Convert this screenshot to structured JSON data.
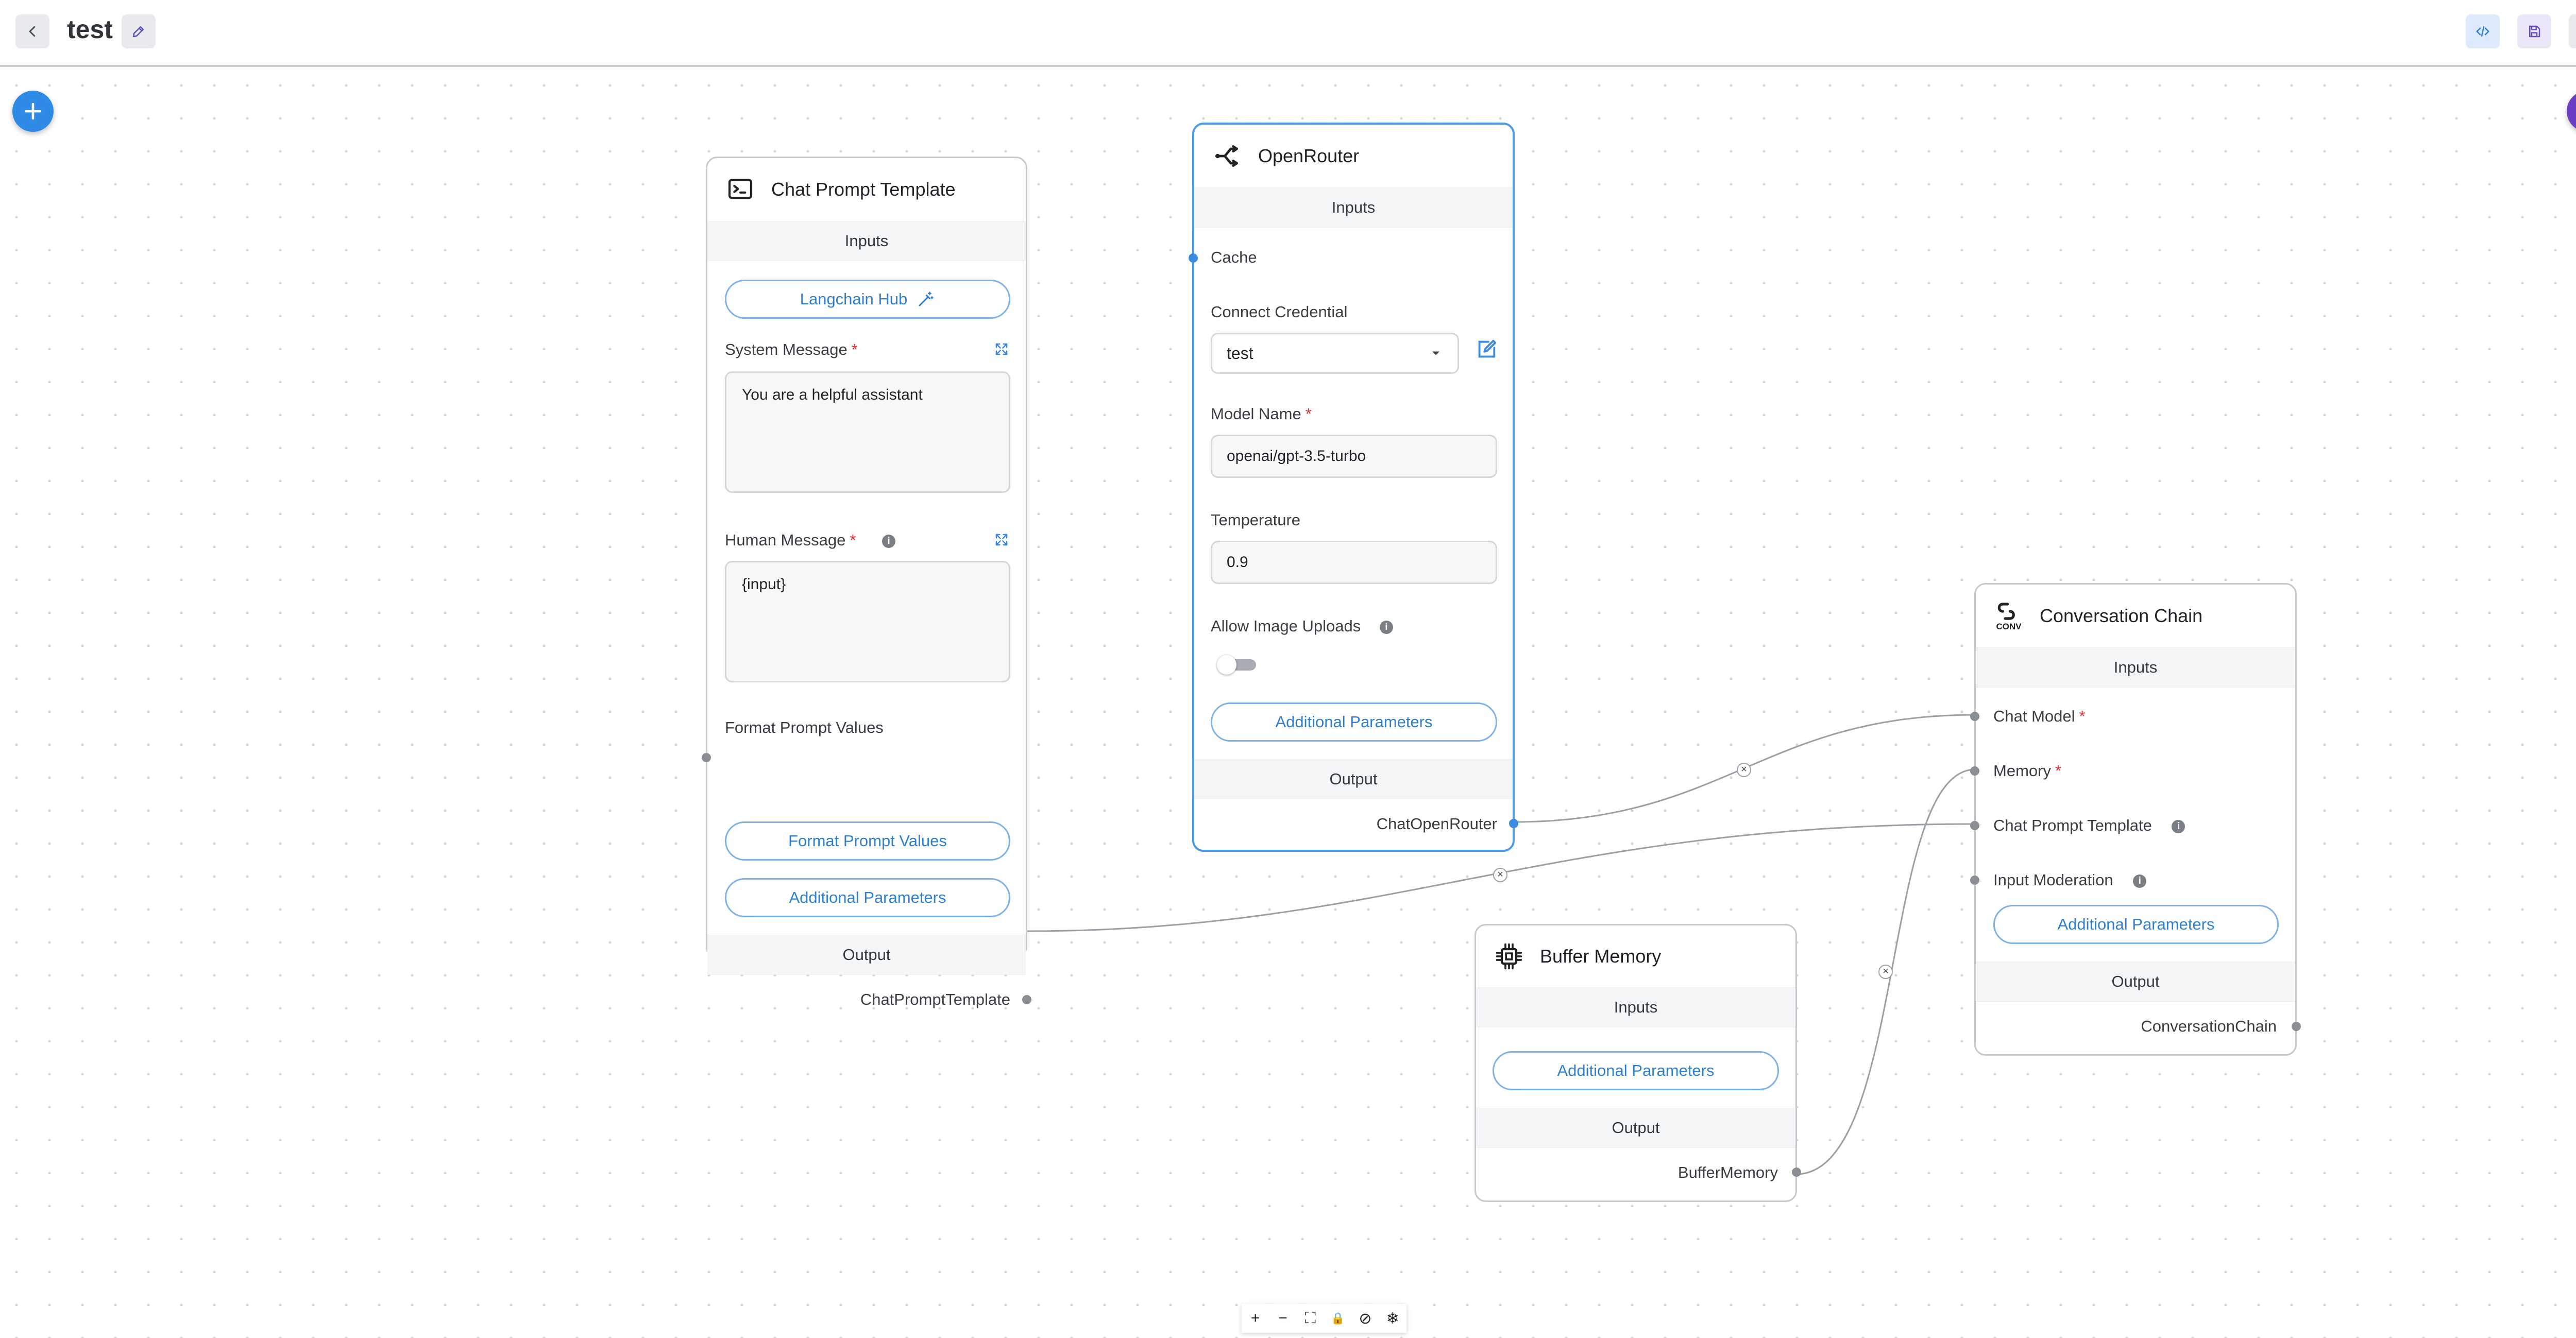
{
  "header": {
    "title": "test",
    "back_icon": "chevron-left-icon",
    "edit_icon": "pencil-icon",
    "code_icon": "code-icon",
    "save_icon": "save-icon",
    "settings_icon": "gear-icon"
  },
  "colors": {
    "accent": "#3b8be0",
    "add_button": "#2d8be6",
    "chat_button": "#6b3fc4",
    "selected_border": "#4c9be8"
  },
  "nodes": {
    "chat_prompt": {
      "title": "Chat Prompt Template",
      "inputs_label": "Inputs",
      "langchain_hub_label": "Langchain Hub",
      "system_message_label": "System Message",
      "system_message_value": "You are a helpful assistant",
      "human_message_label": "Human Message",
      "human_message_value": "{input}",
      "format_prompt_values_label": "Format Prompt Values",
      "format_prompt_values_button": "Format Prompt Values",
      "additional_parameters": "Additional Parameters",
      "output_label": "Output",
      "output_name": "ChatPromptTemplate"
    },
    "openrouter": {
      "title": "OpenRouter",
      "inputs_label": "Inputs",
      "cache_label": "Cache",
      "credential_label": "Connect Credential",
      "credential_value": "test",
      "model_name_label": "Model Name",
      "model_name_value": "openai/gpt-3.5-turbo",
      "temperature_label": "Temperature",
      "temperature_value": "0.9",
      "allow_image_uploads_label": "Allow Image Uploads",
      "allow_image_uploads_on": false,
      "additional_parameters": "Additional Parameters",
      "output_label": "Output",
      "output_name": "ChatOpenRouter"
    },
    "conversation_chain": {
      "title": "Conversation Chain",
      "icon_text": "CONV",
      "inputs_label": "Inputs",
      "chat_model_label": "Chat Model",
      "memory_label": "Memory",
      "chat_prompt_template_label": "Chat Prompt Template",
      "input_moderation_label": "Input Moderation",
      "additional_parameters": "Additional Parameters",
      "output_label": "Output",
      "output_name": "ConversationChain"
    },
    "buffer_memory": {
      "title": "Buffer Memory",
      "inputs_label": "Inputs",
      "additional_parameters": "Additional Parameters",
      "output_label": "Output",
      "output_name": "BufferMemory"
    }
  },
  "required_mark": "*",
  "info_mark": "i",
  "edge_delete_mark": "×",
  "controls": [
    "+",
    "−",
    "⛶",
    "🔒",
    "⊘",
    "❄"
  ]
}
